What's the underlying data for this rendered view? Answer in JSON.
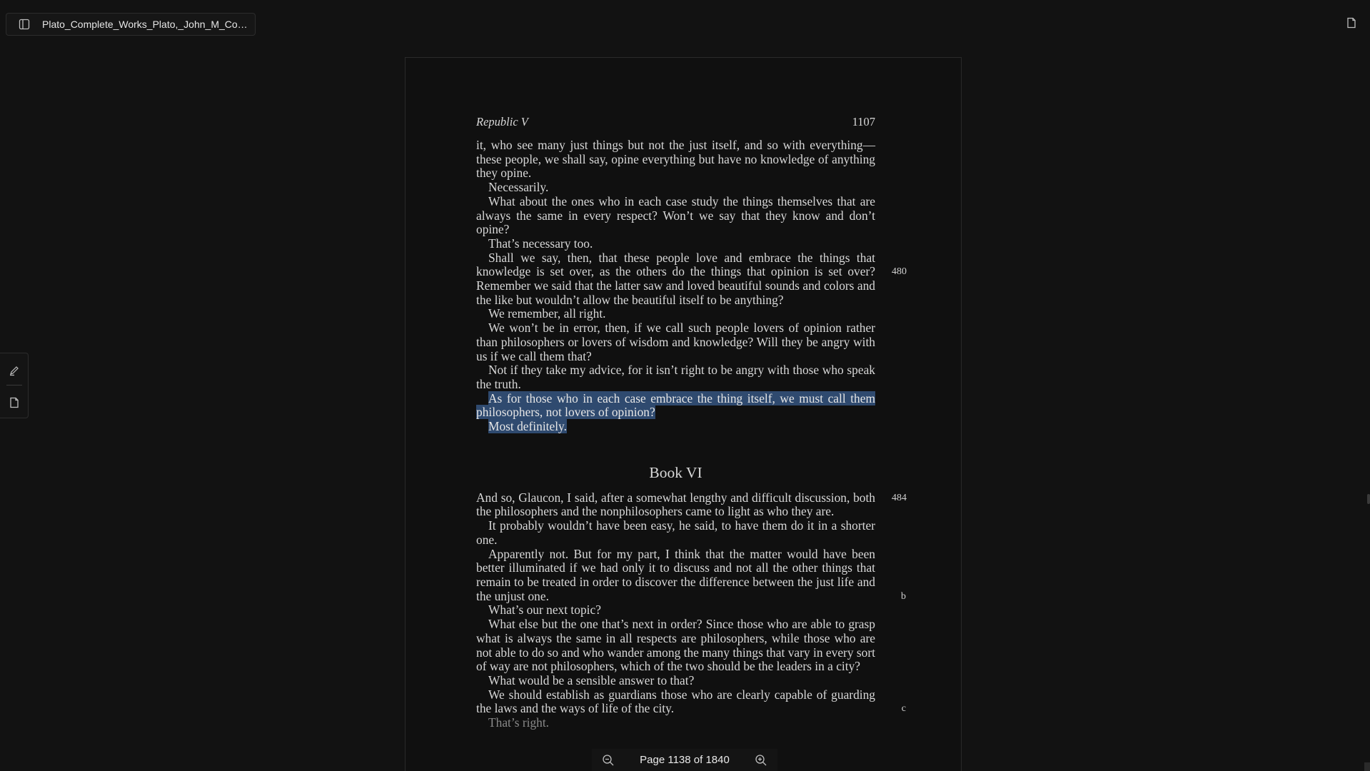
{
  "tab": {
    "title": "Plato_Complete_Works_Plato,_John_M_Coo..."
  },
  "page": {
    "running_head_title": "Republic V",
    "running_head_number": "1107",
    "blocks_before_heading": [
      {
        "text": "it, who see many just things but not the just itself, and so with everything—these people, we shall say, opine everything but have no knowledge of anything they opine.",
        "indent": false
      },
      {
        "text": "Necessarily.",
        "indent": true
      },
      {
        "text": "What about the ones who in each case study the things themselves that are always the same in every respect? Won’t we say that they know and don’t opine?",
        "indent": true
      },
      {
        "text": "That’s necessary too.",
        "indent": true
      },
      {
        "text": "Shall we say, then, that these people love and embrace the things that knowledge is set over, as the others do the things that opinion is set over? Remember we said that the latter saw and loved beautiful sounds and colors and the like but wouldn’t allow the beautiful itself to be anything?",
        "indent": true,
        "margin": "480"
      },
      {
        "text": "We remember, all right.",
        "indent": true
      },
      {
        "text": "We won’t be in error, then, if we call such people lovers of opinion rather than philosophers or lovers of wisdom and knowledge? Will they be angry with us if we call them that?",
        "indent": true
      },
      {
        "text": "Not if they take my advice, for it isn’t right to be angry with those who speak the truth.",
        "indent": true
      }
    ],
    "highlighted_1": "As for those who in each case embrace the thing itself, we must call them philosophers, not lovers of opinion?",
    "highlighted_2": "Most definitely.",
    "book_heading": "Book VI",
    "blocks_after_heading": [
      {
        "text": "And so, Glaucon, I said, after a somewhat lengthy and difficult discussion, both the philosophers and the nonphilosophers came to light as who they are.",
        "indent": false,
        "margin": "484"
      },
      {
        "text": "It probably wouldn’t have been easy, he said, to have them do it in a shorter one.",
        "indent": true
      },
      {
        "text": "Apparently not. But for my part, I think that the matter would have been better illuminated if we had only it to discuss and not all the other things that remain to be treated in order to discover the difference between the just life and the unjust one.",
        "indent": true,
        "margin": "b"
      },
      {
        "text": "What’s our next topic?",
        "indent": true
      },
      {
        "text": "What else but the one that’s next in order? Since those who are able to grasp what is always the same in all respects are philosophers, while those who are not able to do so and who wander among the many things that vary in every sort of way are not philosophers, which of the two should be the leaders in a city?",
        "indent": true
      },
      {
        "text": "What would be a sensible answer to that?",
        "indent": true
      },
      {
        "text": "We should establish as guardians those who are clearly capable of guarding the laws and the ways of life of the city.",
        "indent": true,
        "margin": "c"
      },
      {
        "text": "That’s right.",
        "indent": true,
        "faded": true
      }
    ]
  },
  "zoom": {
    "page_indicator": "Page 1138 of 1840"
  },
  "icons": {
    "sidebar_toggle": "sidebar-toggle-icon",
    "top_right": "bookmark-icon",
    "annotate": "pen-icon",
    "note": "note-icon",
    "zoom_out": "zoom-out-icon",
    "zoom_in": "zoom-in-icon"
  },
  "colors": {
    "background": "#121212",
    "page": "#101010",
    "highlight": "#2f4a6f",
    "text": "#d8d8d8"
  }
}
